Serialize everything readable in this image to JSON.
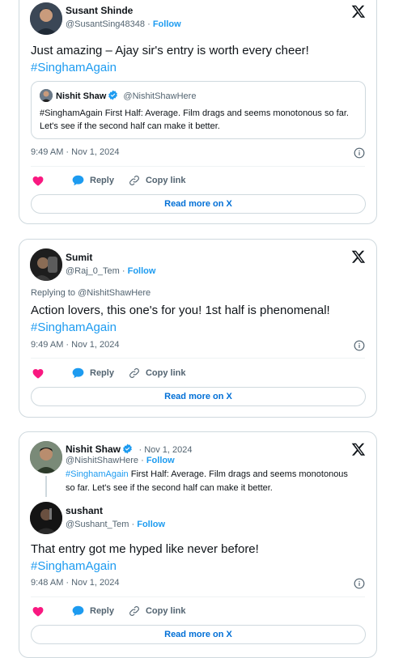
{
  "colors": {
    "accent": "#1d9bf0",
    "like": "#f91880",
    "muted": "#536471",
    "border": "#cfd9de"
  },
  "icons": {
    "logo": "x-logo-icon",
    "like": "heart-icon",
    "reply": "reply-bubble-icon",
    "copy": "link-icon",
    "info": "info-icon",
    "verified": "verified-badge-icon"
  },
  "tweets": [
    {
      "author": {
        "name": "Susant Shinde",
        "handle": "@SusantSing48348",
        "follow": "Follow"
      },
      "text": "Just amazing – Ajay sir's entry is worth every cheer!",
      "hashtag": "#SinghamAgain",
      "quote": {
        "name": "Nishit Shaw",
        "handle": "@NishitShawHere",
        "text": "#SinghamAgain First Half: Average. Film drags and seems monotonous so far. Let's see if the second half can make it better."
      },
      "timestamp": "9:49 AM · Nov 1, 2024",
      "actions": {
        "reply": "Reply",
        "copy": "Copy link"
      },
      "read_more": "Read more on X"
    },
    {
      "author": {
        "name": "Sumit",
        "handle": "@Raj_0_Tem",
        "follow": "Follow"
      },
      "replying_to": "Replying to @NishitShawHere",
      "text": "Action lovers, this one's for you! 1st half is phenomenal!",
      "hashtag": "#SinghamAgain",
      "timestamp": "9:49 AM · Nov 1, 2024",
      "actions": {
        "reply": "Reply",
        "copy": "Copy link"
      },
      "read_more": "Read more on X"
    },
    {
      "parent": {
        "name": "Nishit Shaw",
        "date": "· Nov 1, 2024",
        "handle": "@NishitShawHere",
        "follow": "Follow",
        "hashtag": "#SinghamAgain",
        "text": " First Half: Average. Film drags and seems monotonous so far. Let's see if the second half can make it better."
      },
      "author": {
        "name": "sushant",
        "handle": "@Sushant_Tem",
        "follow": "Follow"
      },
      "text": "That entry got me hyped like never before!",
      "hashtag": "#SinghamAgain",
      "timestamp": "9:48 AM · Nov 1, 2024",
      "actions": {
        "reply": "Reply",
        "copy": "Copy link"
      },
      "read_more": "Read more on X"
    }
  ]
}
